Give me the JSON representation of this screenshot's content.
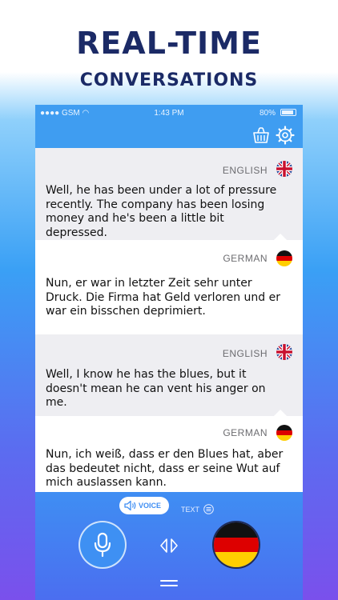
{
  "promo": {
    "headline": "REAL-TIME",
    "subheadline": "CONVERSATIONS"
  },
  "status_bar": {
    "carrier": "GSM",
    "time": "1:43 PM",
    "battery": "80%"
  },
  "toolbar": {
    "clear_icon": "basket-icon",
    "settings_icon": "gear-icon"
  },
  "messages": [
    {
      "language": "ENGLISH",
      "flag": "uk-flag-icon",
      "text": "Well, he has been under a lot of pressure recently.  The company has been losing money and he's been a little bit depressed."
    },
    {
      "language": "GERMAN",
      "flag": "germany-flag-icon",
      "text": "Nun, er war in letzter Zeit sehr unter Druck. Die Firma hat Geld verloren und er war ein bisschen deprimiert."
    },
    {
      "language": "ENGLISH",
      "flag": "uk-flag-icon",
      "text": "Well, I know he has the blues, but it doesn't mean he can vent his anger on me."
    },
    {
      "language": "GERMAN",
      "flag": "germany-flag-icon",
      "text": "Nun, ich weiß, dass er den Blues hat, aber das bedeutet nicht, dass er seine Wut auf mich auslassen kann."
    }
  ],
  "controls": {
    "voice_label": "VOICE",
    "text_label": "TEXT",
    "selected_mode": "VOICE",
    "target_flag": "germany-flag-icon"
  },
  "colors": {
    "accent": "#3f9df1",
    "headline": "#1b2a66",
    "english_bubble": "#eeeef2"
  }
}
